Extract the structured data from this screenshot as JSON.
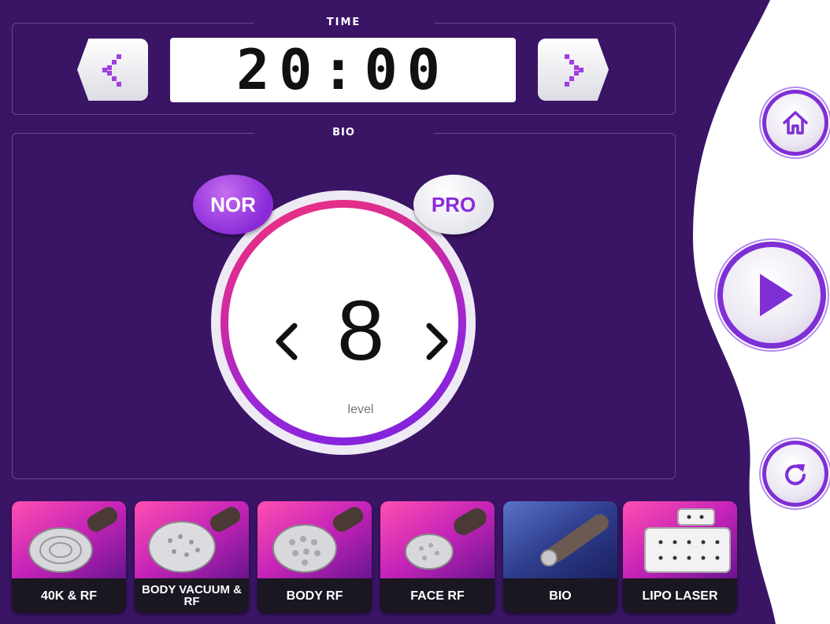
{
  "colors": {
    "panel_bg": "#3a1566",
    "accent": "#8a2ad8",
    "ring_start": "#f0307a",
    "ring_end": "#7a22e0"
  },
  "time": {
    "title": "TIME",
    "value": "20:00",
    "prev_icon": "chevron-left-icon",
    "next_icon": "chevron-right-icon"
  },
  "bio": {
    "title": "BIO",
    "modes": [
      "NOR",
      "PRO"
    ],
    "selected_mode": "NOR",
    "level": "8",
    "level_label": "level"
  },
  "side_buttons": {
    "home_icon": "home-icon",
    "start_icon": "play-icon",
    "reset_icon": "refresh-icon"
  },
  "handpieces": [
    {
      "label": "40K & RF",
      "selected": false
    },
    {
      "label": "BODY VACUUM & RF",
      "selected": false
    },
    {
      "label": "BODY RF",
      "selected": false
    },
    {
      "label": "FACE RF",
      "selected": false
    },
    {
      "label": "BIO",
      "selected": true
    },
    {
      "label": "LIPO LASER",
      "selected": false
    }
  ]
}
